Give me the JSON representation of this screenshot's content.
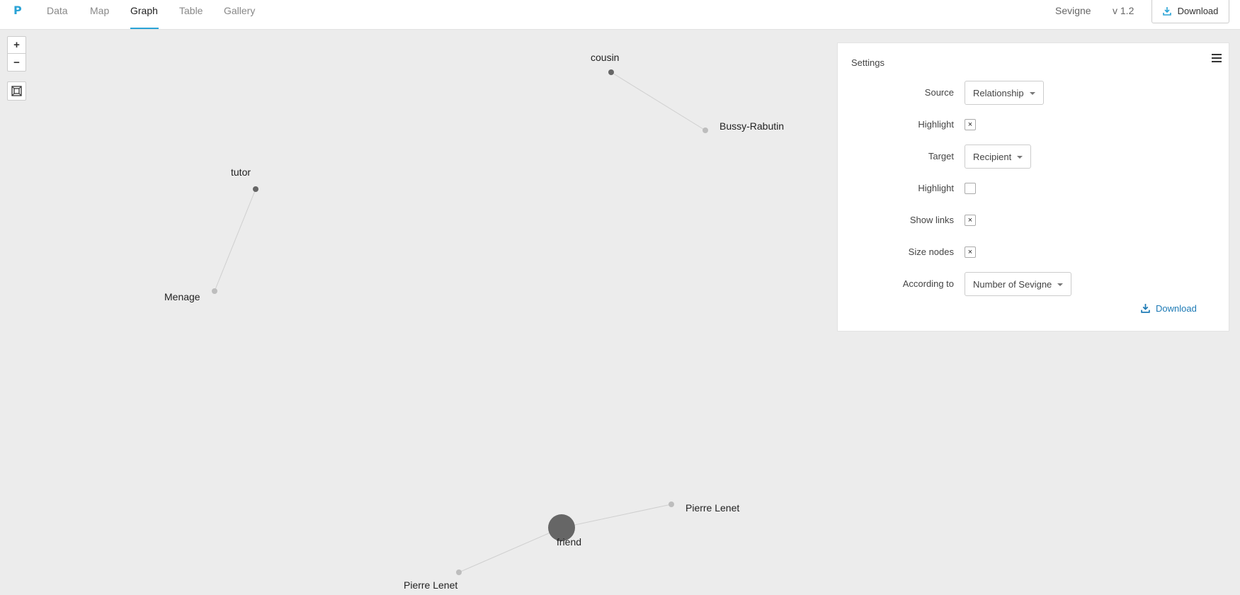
{
  "app": {
    "logo_text": "P",
    "tabs": [
      {
        "label": "Data"
      },
      {
        "label": "Map"
      },
      {
        "label": "Graph",
        "active": true
      },
      {
        "label": "Table"
      },
      {
        "label": "Gallery"
      }
    ],
    "project_name": "Sevigne",
    "version": "v 1.2",
    "download_label": "Download",
    "accent_color": "#2aa3d6"
  },
  "zoom_controls": {
    "zoom_in": "+",
    "zoom_out": "−",
    "fit_icon": "fit-to-screen-icon"
  },
  "graph": {
    "nodes": [
      {
        "label": "cousin",
        "role": "source"
      },
      {
        "label": "Bussy-Rabutin",
        "role": "target"
      },
      {
        "label": "tutor",
        "role": "source"
      },
      {
        "label": "Menage",
        "role": "target"
      },
      {
        "label": "friend",
        "role": "source",
        "size": "large"
      },
      {
        "label": "Pierre Lenet",
        "role": "target"
      },
      {
        "label": "Pierre Lenet",
        "role": "target"
      }
    ],
    "links": [
      [
        "cousin",
        "Bussy-Rabutin"
      ],
      [
        "tutor",
        "Menage"
      ],
      [
        "friend",
        "Pierre Lenet"
      ],
      [
        "friend",
        "Pierre Lenet"
      ]
    ],
    "source_color": "#666666",
    "target_color": "#bdbdbd"
  },
  "settings": {
    "title": "Settings",
    "source_label": "Source",
    "source_value": "Relationship",
    "highlight_label": "Highlight",
    "source_highlight": "×",
    "target_label": "Target",
    "target_value": "Recipient",
    "target_highlight": "",
    "show_links_label": "Show links",
    "show_links": "×",
    "size_nodes_label": "Size nodes",
    "size_nodes": "×",
    "according_to_label": "According to",
    "according_to_value": "Number of Sevigne",
    "download_label": "Download",
    "link_color": "#1d7ab5"
  }
}
